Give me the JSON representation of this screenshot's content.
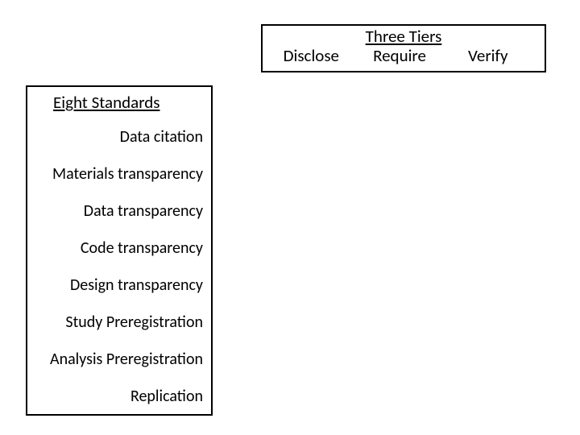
{
  "tiers": {
    "title": "Three Tiers",
    "columns": [
      "Disclose",
      "Require",
      "Verify"
    ]
  },
  "standards": {
    "title": "Eight Standards",
    "items": [
      "Data citation",
      "Materials transparency",
      "Data transparency",
      "Code transparency",
      "Design transparency",
      "Study Preregistration",
      "Analysis Preregistration",
      "Replication"
    ]
  }
}
